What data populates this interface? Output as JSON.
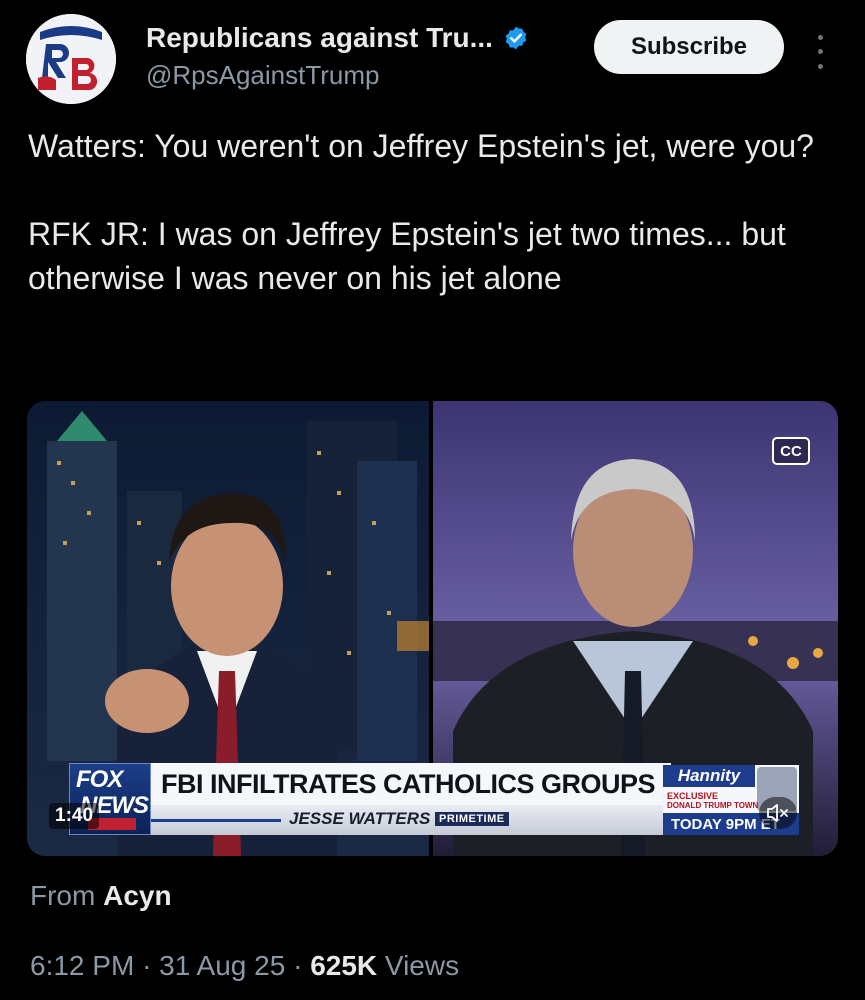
{
  "account": {
    "display_name": "Republicans against Tru...",
    "handle": "@RpsAgainstTrump",
    "avatar_text": "RB",
    "verified": true
  },
  "subscribe_label": "Subscribe",
  "tweet": {
    "line1": "Watters: You weren't on Jeffrey Epstein's jet, were you?",
    "line2": "RFK JR: I was on Jeffrey Epstein's jet two times... but otherwise I was never on his jet alone"
  },
  "video": {
    "cc_label": "CC",
    "timestamp": "1:40",
    "chyron_headline": "FBI INFILTRATES CATHOLICS GROUPS",
    "show_name": "JESSE WATTERS",
    "show_tag": "PRIMETIME",
    "network_line1": "FOX",
    "network_line2": "NEWS",
    "promo_show": "Hannity",
    "promo_exclusive": "EXCLUSIVE",
    "promo_town_hall": "DONALD TRUMP TOWN",
    "promo_time": "TODAY 9PM ET"
  },
  "attribution": {
    "prefix": "From",
    "source": "Acyn"
  },
  "meta": {
    "time": "6:12 PM",
    "date": "31 Aug 25",
    "views_count": "625K",
    "views_label": "Views",
    "separator": "·"
  },
  "colors": {
    "background": "#000000",
    "text_primary": "#e7e9ea",
    "text_secondary": "#8b98a5",
    "verified_blue": "#1d9bf0"
  },
  "icons": {
    "verified": "verified-badge-icon",
    "more": "more-dots-icon",
    "cc": "closed-captions-icon",
    "mute": "mute-speaker-icon"
  }
}
